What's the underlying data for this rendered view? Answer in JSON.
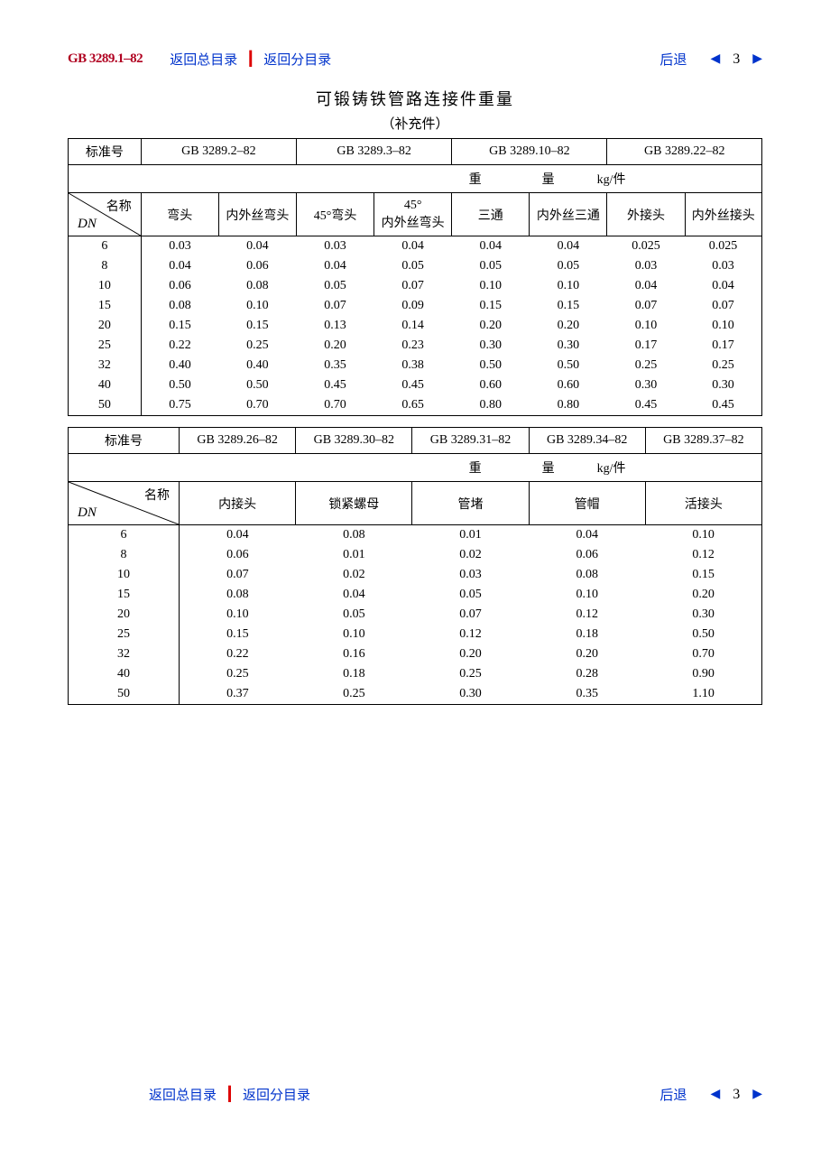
{
  "nav": {
    "standard_code": "GB 3289.1–82",
    "link_main": "返回总目录",
    "link_sub": "返回分目录",
    "link_back": "后退",
    "page_num": "3",
    "separator": "┃"
  },
  "doc": {
    "title": "可锻铸铁管路连接件重量",
    "subtitle": "（补充件）",
    "weight_label_1": "重",
    "weight_label_2": "量",
    "weight_unit": "kg/件",
    "std_label": "标准号",
    "name_label": "名称",
    "dn_label": "DN"
  },
  "table1": {
    "standards": [
      "GB 3289.2–82",
      "GB 3289.3–82",
      "GB 3289.10–82",
      "GB 3289.22–82"
    ],
    "columns": [
      "弯头",
      "内外丝弯头",
      "45°弯头",
      "45°\n内外丝弯头",
      "三通",
      "内外丝三通",
      "外接头",
      "内外丝接头"
    ],
    "dn": [
      "6",
      "8",
      "10",
      "15",
      "20",
      "25",
      "32",
      "40",
      "50"
    ],
    "rows": [
      [
        "0.03",
        "0.04",
        "0.03",
        "0.04",
        "0.04",
        "0.04",
        "0.025",
        "0.025"
      ],
      [
        "0.04",
        "0.06",
        "0.04",
        "0.05",
        "0.05",
        "0.05",
        "0.03",
        "0.03"
      ],
      [
        "0.06",
        "0.08",
        "0.05",
        "0.07",
        "0.10",
        "0.10",
        "0.04",
        "0.04"
      ],
      [
        "0.08",
        "0.10",
        "0.07",
        "0.09",
        "0.15",
        "0.15",
        "0.07",
        "0.07"
      ],
      [
        "0.15",
        "0.15",
        "0.13",
        "0.14",
        "0.20",
        "0.20",
        "0.10",
        "0.10"
      ],
      [
        "0.22",
        "0.25",
        "0.20",
        "0.23",
        "0.30",
        "0.30",
        "0.17",
        "0.17"
      ],
      [
        "0.40",
        "0.40",
        "0.35",
        "0.38",
        "0.50",
        "0.50",
        "0.25",
        "0.25"
      ],
      [
        "0.50",
        "0.50",
        "0.45",
        "0.45",
        "0.60",
        "0.60",
        "0.30",
        "0.30"
      ],
      [
        "0.75",
        "0.70",
        "0.70",
        "0.65",
        "0.80",
        "0.80",
        "0.45",
        "0.45"
      ]
    ]
  },
  "table2": {
    "standards": [
      "GB 3289.26–82",
      "GB 3289.30–82",
      "GB 3289.31–82",
      "GB 3289.34–82",
      "GB 3289.37–82"
    ],
    "columns": [
      "内接头",
      "锁紧螺母",
      "管堵",
      "管帽",
      "活接头"
    ],
    "dn": [
      "6",
      "8",
      "10",
      "15",
      "20",
      "25",
      "32",
      "40",
      "50"
    ],
    "rows": [
      [
        "0.04",
        "0.08",
        "0.01",
        "0.04",
        "0.10"
      ],
      [
        "0.06",
        "0.01",
        "0.02",
        "0.06",
        "0.12"
      ],
      [
        "0.07",
        "0.02",
        "0.03",
        "0.08",
        "0.15"
      ],
      [
        "0.08",
        "0.04",
        "0.05",
        "0.10",
        "0.20"
      ],
      [
        "0.10",
        "0.05",
        "0.07",
        "0.12",
        "0.30"
      ],
      [
        "0.15",
        "0.10",
        "0.12",
        "0.18",
        "0.50"
      ],
      [
        "0.22",
        "0.16",
        "0.20",
        "0.20",
        "0.70"
      ],
      [
        "0.25",
        "0.18",
        "0.25",
        "0.28",
        "0.90"
      ],
      [
        "0.37",
        "0.25",
        "0.30",
        "0.35",
        "1.10"
      ]
    ]
  }
}
